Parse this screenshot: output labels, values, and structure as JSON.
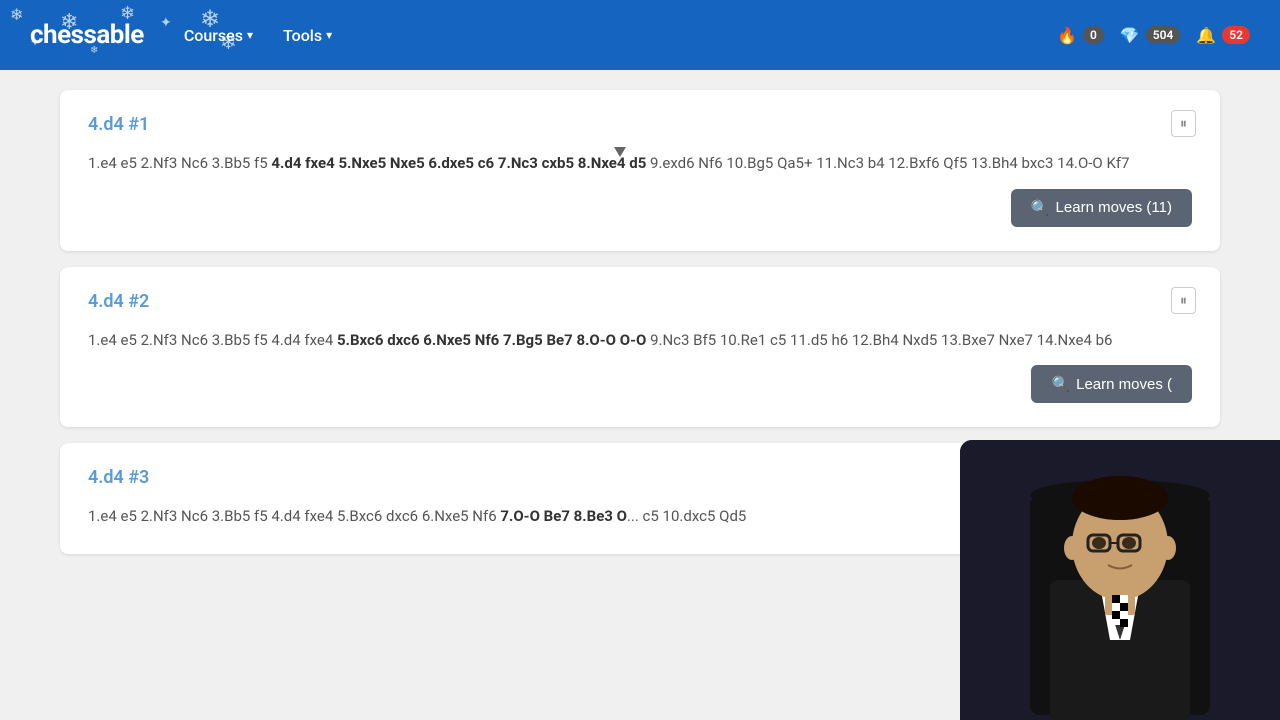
{
  "header": {
    "logo": "chessable",
    "nav": [
      {
        "label": "Courses",
        "hasDropdown": true
      },
      {
        "label": "Tools",
        "hasDropdown": true
      }
    ],
    "icons": {
      "fire": "🔥",
      "fire_count": "0",
      "diamond": "💎",
      "diamond_count": "504",
      "bell": "🔔",
      "bell_count": "52"
    }
  },
  "cards": [
    {
      "id": "card-1",
      "title": "4.d4 #1",
      "moves_normal": "1.e4 e5 2.Nf3 Nc6 3.Bb5 f5 ",
      "moves_bold": "4.d4 fxe4 5.Nxe5 Nxe5 6.dxe5 c6 7.Nc3 cxb5 8.Nxe4 d5",
      "moves_normal2": " 9.exd6 Nf6 10.Bg5 Qa5+ 11.Nc3 b4 12.Bxf6 Qf5 13.Bh4 bxc3 14.O-O Kf7",
      "button_label": "Learn moves (11)",
      "button_icon": "🔍"
    },
    {
      "id": "card-2",
      "title": "4.d4 #2",
      "moves_normal": "1.e4 e5 2.Nf3 Nc6 3.Bb5 f5 4.d4 fxe4 ",
      "moves_bold": "5.Bxc6 dxc6 6.Nxe5 Nf6 7.Bg5 Be7 8.O-O O-O",
      "moves_normal2": " 9.Nc3 Bf5 10.Re1 c5 11.d5 h6 12.Bh4 Nxd5 13.Bxe7 Nxe7 14.Nxe4 b6",
      "button_label": "Learn moves (",
      "button_icon": "🔍"
    },
    {
      "id": "card-3",
      "title": "4.d4 #3",
      "moves_normal": "1.e4 e5 2.Nf3 Nc6 3.Bb5 f5 4.d4 fxe4 5.Bxc6 dxc6 6.Nxe5 Nf6 ",
      "moves_bold": "7.O-O Be7 8.Be3 O",
      "moves_normal2": "... c5 10.dxc5 Qd5",
      "button_label": null,
      "button_icon": null
    }
  ]
}
